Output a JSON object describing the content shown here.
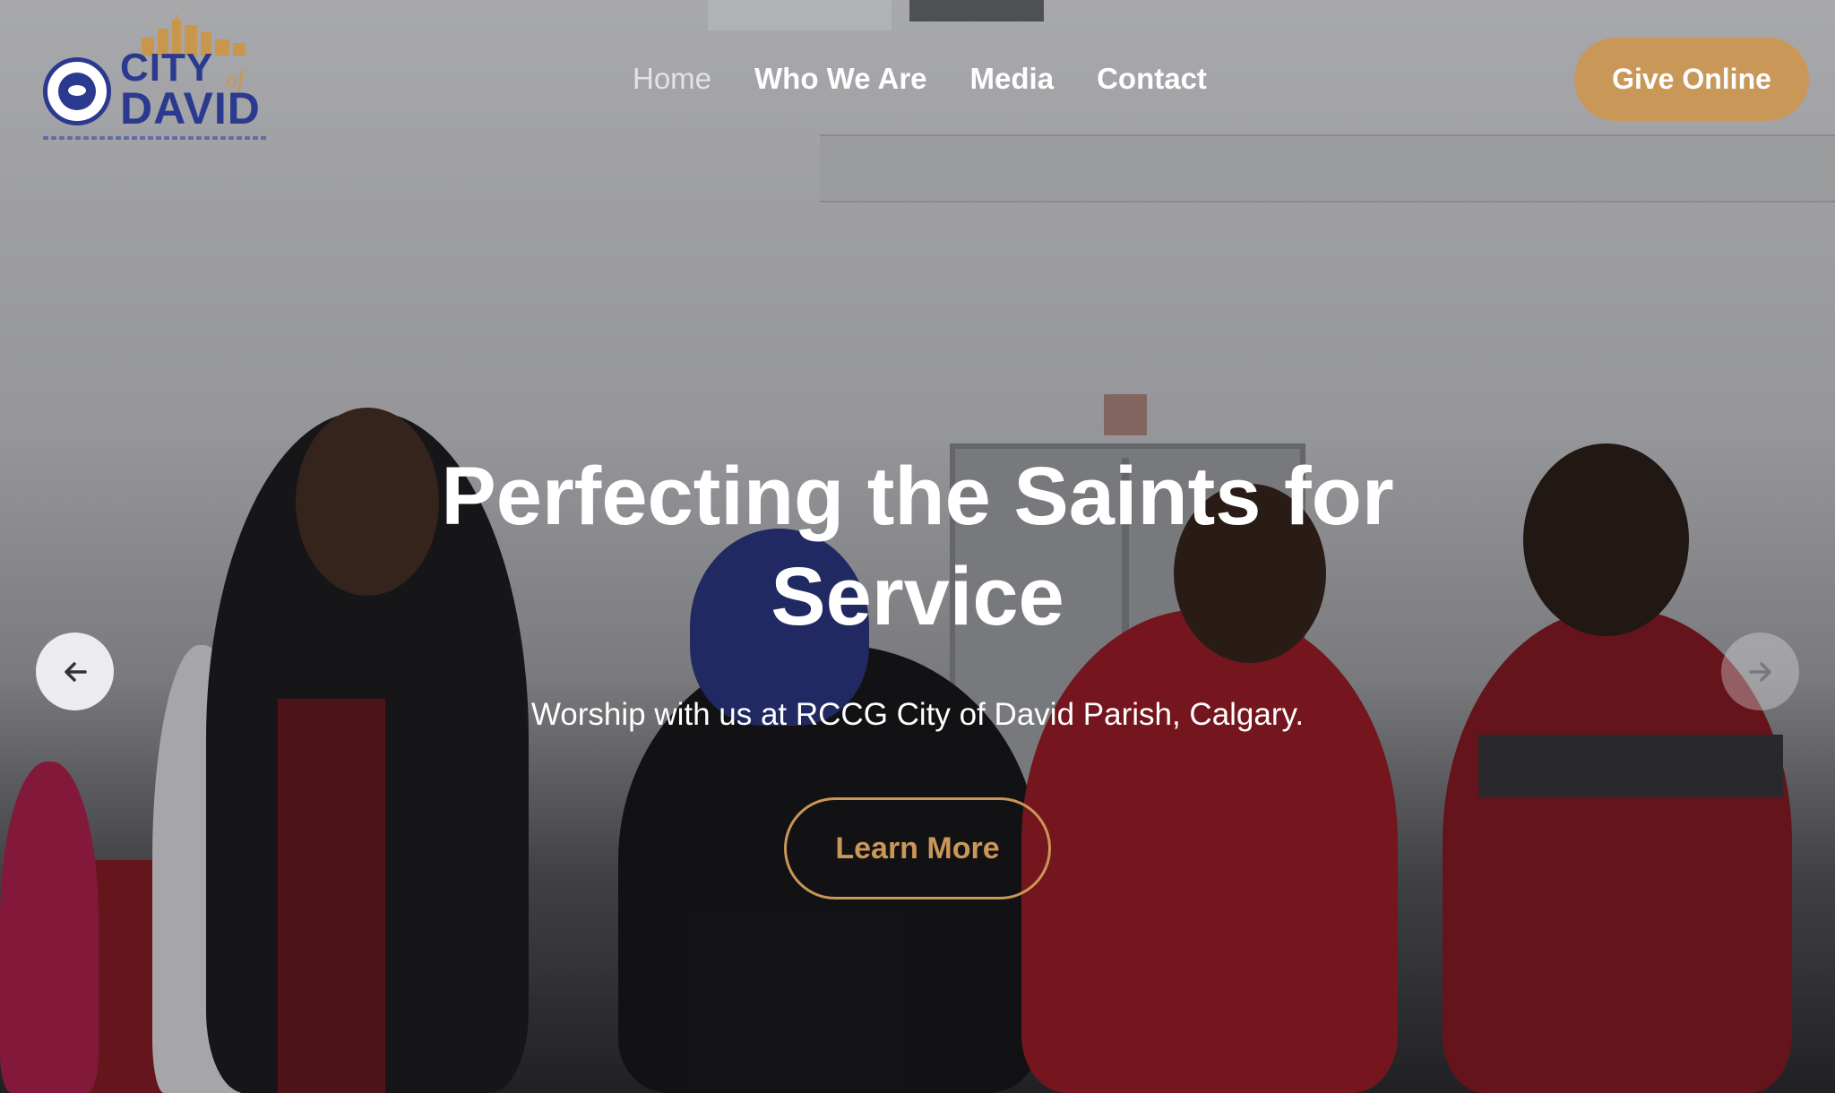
{
  "header": {
    "logo": {
      "line1": "CITY",
      "line2": "of",
      "line3": "DAVID"
    },
    "nav": [
      {
        "label": "Home",
        "active": true
      },
      {
        "label": "Who We Are",
        "active": false
      },
      {
        "label": "Media",
        "active": false
      },
      {
        "label": "Contact",
        "active": false
      }
    ],
    "give_button": "Give Online"
  },
  "hero": {
    "title": "Perfecting the Saints for Service",
    "subtitle": "Worship with us at RCCG City of David Parish, Calgary.",
    "cta": "Learn More",
    "prev_icon": "arrow-left-icon",
    "next_icon": "arrow-right-icon"
  },
  "colors": {
    "accent": "#c99757",
    "brand_blue": "#2b3a8f",
    "text_light": "#ffffff"
  }
}
